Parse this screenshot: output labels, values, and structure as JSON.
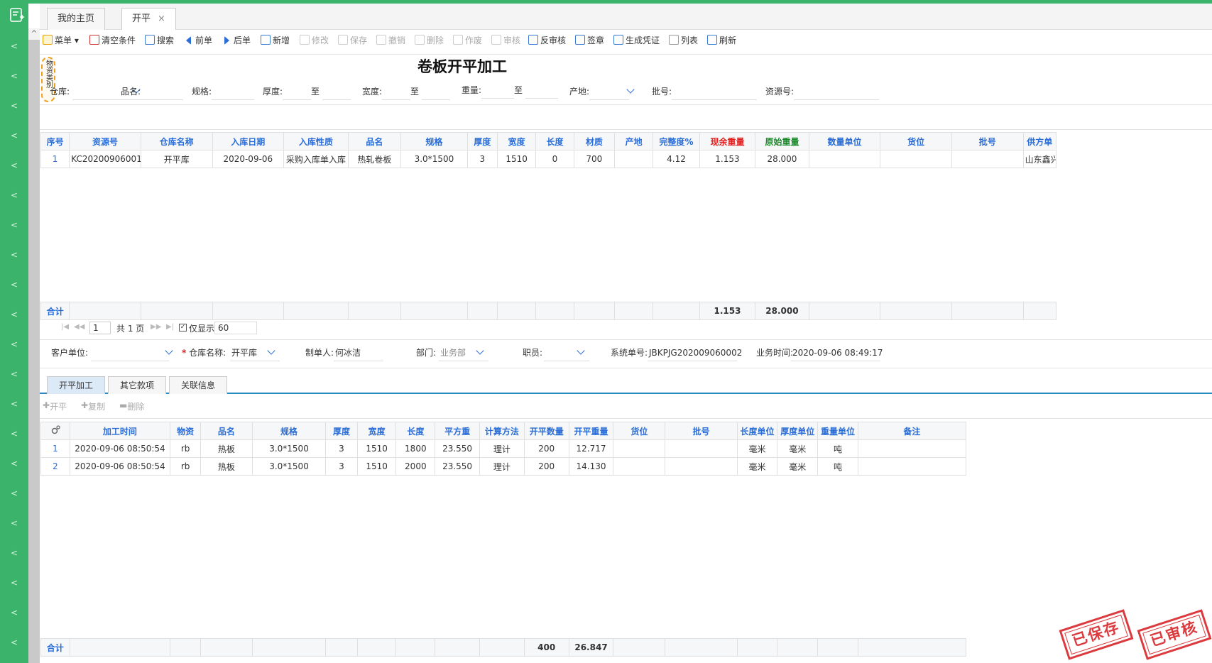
{
  "tabs": [
    {
      "label": "我的主页"
    },
    {
      "label": "开平",
      "close": "×"
    }
  ],
  "toolbar": {
    "menu": "菜单",
    "clear": "清空条件",
    "search": "搜索",
    "prev": "前单",
    "next": "后单",
    "add": "新增",
    "edit": "修改",
    "save": "保存",
    "revoke": "撤销",
    "delete": "删除",
    "void": "作废",
    "audit": "审核",
    "unaudit": "反审核",
    "sign": "签章",
    "voucher": "生成凭证",
    "list": "列表",
    "refresh": "刷新"
  },
  "page_title": "卷板开平加工",
  "side_stamp": "物资类别",
  "filters": {
    "warehouse": "仓库:",
    "product": "品名:",
    "spec": "规格:",
    "thickness": "厚度:",
    "width": "宽度:",
    "weight": "重量:",
    "to": "至",
    "origin": "产地:",
    "batch": "批号:",
    "resource": "资源号:"
  },
  "grid1": {
    "columns": [
      "序号",
      "资源号",
      "仓库名称",
      "入库日期",
      "入库性质",
      "品名",
      "规格",
      "厚度",
      "宽度",
      "长度",
      "材质",
      "产地",
      "完整度%",
      "现余重量",
      "原始重量",
      "数量单位",
      "货位",
      "批号",
      "供方单"
    ],
    "rows": [
      [
        "1",
        "KC20200906001",
        "开平库",
        "2020-09-06",
        "采购入库单入库",
        "热轧卷板",
        "3.0*1500",
        "3",
        "1510",
        "0",
        "700",
        "",
        "4.12",
        "1.153",
        "28.000",
        "",
        "",
        "",
        "山东鑫兴"
      ]
    ],
    "sum_label": "合计",
    "sum_remaining": "1.153",
    "sum_original": "28.000"
  },
  "pager": {
    "page": "1",
    "total": "共 1 页",
    "show_only": "仅显示",
    "show_count": "60"
  },
  "form2": {
    "customer": "客户单位:",
    "warehouse_label": "仓库名称:",
    "warehouse_value": "开平库",
    "maker_label": "制单人:",
    "maker_value": "何冰洁",
    "dept_label": "部门:",
    "dept_value": "业务部",
    "staff_label": "职员:",
    "sysno_label": "系统单号:",
    "sysno_value": "JBKPJG202009060002",
    "time_label": "业务时间:",
    "time_value": "2020-09-06 08:49:17"
  },
  "subtabs": [
    "开平加工",
    "其它款项",
    "关联信息"
  ],
  "subtool": {
    "open": "开平",
    "copy": "复制",
    "remove": "删除"
  },
  "grid2": {
    "columns": [
      "加工时间",
      "物资",
      "品名",
      "规格",
      "厚度",
      "宽度",
      "长度",
      "平方重",
      "计算方法",
      "开平数量",
      "开平重量",
      "货位",
      "批号",
      "长度单位",
      "厚度单位",
      "重量单位",
      "备注"
    ],
    "rows": [
      [
        "1",
        "2020-09-06 08:50:54",
        "rb",
        "热板",
        "3.0*1500",
        "3",
        "1510",
        "1800",
        "23.550",
        "理计",
        "200",
        "12.717",
        "",
        "",
        "毫米",
        "毫米",
        "吨",
        ""
      ],
      [
        "2",
        "2020-09-06 08:50:54",
        "rb",
        "热板",
        "3.0*1500",
        "3",
        "1510",
        "2000",
        "23.550",
        "理计",
        "200",
        "14.130",
        "",
        "",
        "毫米",
        "毫米",
        "吨",
        ""
      ]
    ],
    "sum_label": "合计",
    "sum_qty": "400",
    "sum_weight": "26.847"
  },
  "stamps": {
    "saved": "已保存",
    "audited": "已审核"
  },
  "colors": {
    "sidebar": "#3bb36a",
    "accent": "#2a6dd6",
    "stamp": "#d8262a"
  }
}
